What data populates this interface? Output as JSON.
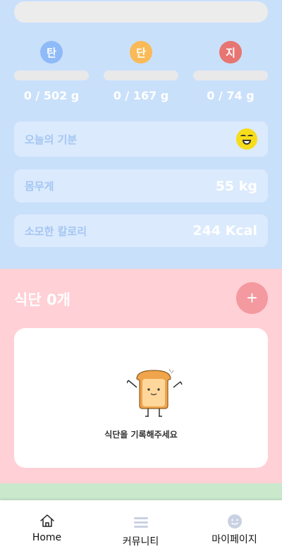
{
  "summary": {
    "macros": [
      {
        "badge": "탄",
        "value": "0 / 502 g",
        "color": "#8fbaf8"
      },
      {
        "badge": "단",
        "value": "0 / 167 g",
        "color": "#f9ba57"
      },
      {
        "badge": "지",
        "value": "0 / 74 g",
        "color": "#e77571"
      }
    ],
    "mood": {
      "label": "오늘의 기분",
      "icon": "laughing-emoji-icon"
    },
    "weight": {
      "label": "몸무게",
      "value": "55 kg"
    },
    "calories": {
      "label": "소모한 칼로리",
      "value": "244 Kcal"
    }
  },
  "meals": {
    "title": "식단 0개",
    "add_label": "+",
    "empty_text": "식단을 기록해주세요",
    "empty_icon": "toast-character-icon"
  },
  "nav": {
    "items": [
      {
        "label": "Home",
        "icon": "home-icon"
      },
      {
        "label": "커뮤니티",
        "icon": "menu-icon"
      },
      {
        "label": "마이페이지",
        "icon": "smile-face-icon"
      }
    ]
  },
  "colors": {
    "summary_bg": "#c9e0fb",
    "meal_bg": "#ffd0d5",
    "accent_add": "#f3999f",
    "next_section": "#c9e8cc"
  }
}
